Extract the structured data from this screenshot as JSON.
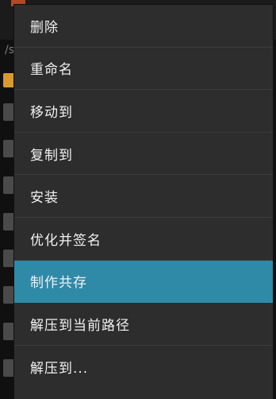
{
  "background": {
    "path_text": "/s"
  },
  "context_menu": {
    "items": [
      {
        "label": "删除"
      },
      {
        "label": "重命名"
      },
      {
        "label": "移动到"
      },
      {
        "label": "复制到"
      },
      {
        "label": "安装"
      },
      {
        "label": "优化并签名"
      },
      {
        "label": "制作共存",
        "selected": true
      },
      {
        "label": "解压到当前路径"
      },
      {
        "label": "解压到..."
      }
    ],
    "selected_color": "#2f8aa8",
    "background_color": "#2d2d2d"
  }
}
